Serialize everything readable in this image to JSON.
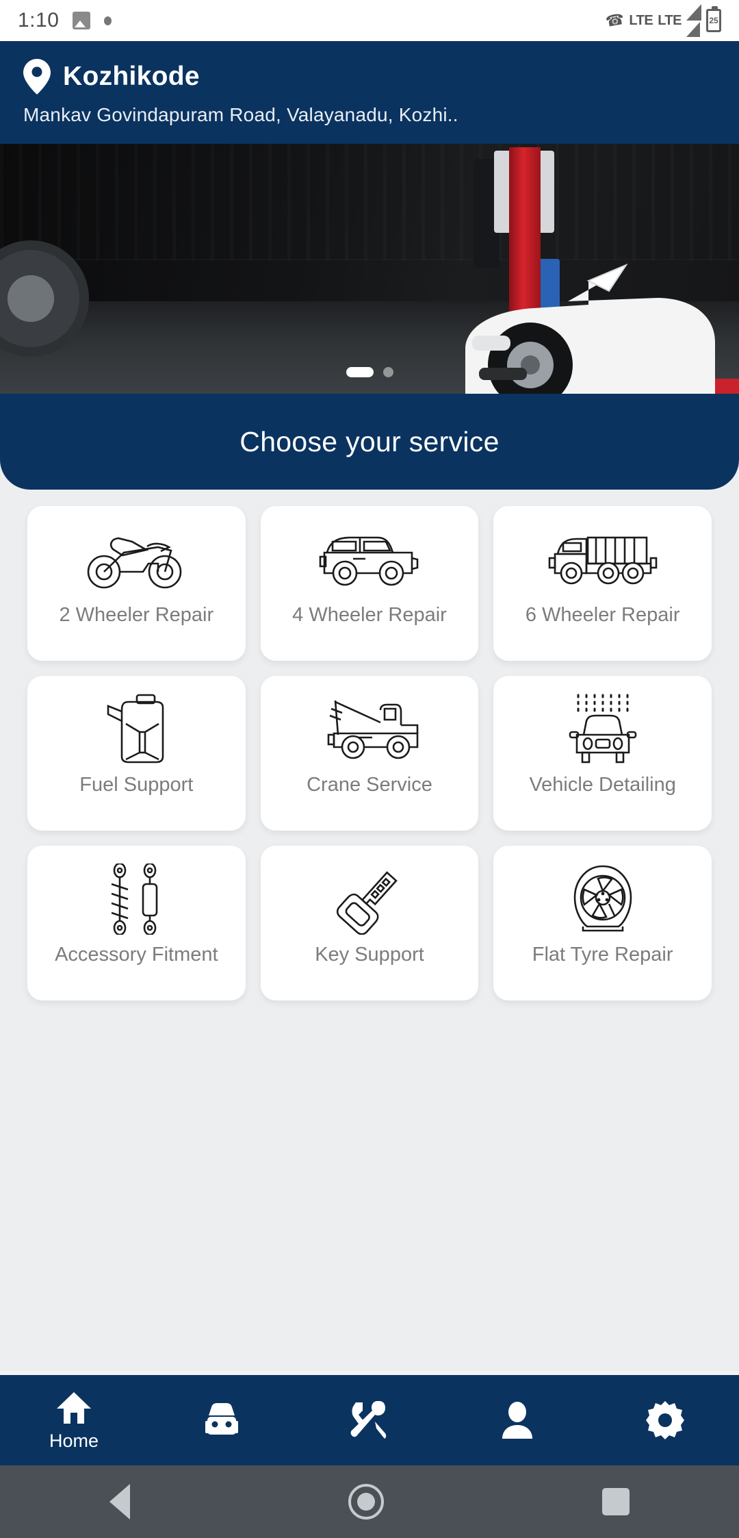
{
  "status_bar": {
    "time": "1:10",
    "icons": [
      "photo-icon",
      "dot-icon"
    ],
    "network_1": "LTE",
    "network_2": "LTE",
    "battery_level": "25"
  },
  "header": {
    "location_icon": "location-pin-icon",
    "city": "Kozhikode",
    "address": "Mankav Govindapuram Road, Valayanadu, Kozhi.."
  },
  "banner": {
    "alt": "car-on-lift-in-garage",
    "slide_count": 2,
    "active_slide": 1
  },
  "section": {
    "title": "Choose your service"
  },
  "services": [
    {
      "label": "2 Wheeler Repair",
      "icon": "motorcycle-icon"
    },
    {
      "label": "4 Wheeler Repair",
      "icon": "car-icon"
    },
    {
      "label": "6 Wheeler Repair",
      "icon": "truck-icon"
    },
    {
      "label": "Fuel Support",
      "icon": "fuel-can-icon"
    },
    {
      "label": "Crane Service",
      "icon": "tow-truck-icon"
    },
    {
      "label": "Vehicle Detailing",
      "icon": "car-wash-icon"
    },
    {
      "label": "Accessory Fitment",
      "icon": "shock-absorber-icon"
    },
    {
      "label": "Key Support",
      "icon": "key-icon"
    },
    {
      "label": "Flat Tyre Repair",
      "icon": "tyre-icon"
    }
  ],
  "bottom_nav": [
    {
      "label": "Home",
      "icon": "home-icon",
      "active": true
    },
    {
      "label": "",
      "icon": "car-icon",
      "active": false
    },
    {
      "label": "",
      "icon": "tools-icon",
      "active": false
    },
    {
      "label": "",
      "icon": "person-icon",
      "active": false
    },
    {
      "label": "",
      "icon": "gear-icon",
      "active": false
    }
  ],
  "android_nav": {
    "back": "back-triangle-icon",
    "home": "home-circle-icon",
    "recents": "recents-square-icon"
  },
  "colors": {
    "brand_navy": "#0a3360",
    "page_bg": "#eceef0",
    "card_bg": "#ffffff",
    "label_gray": "#7c7c7c"
  }
}
